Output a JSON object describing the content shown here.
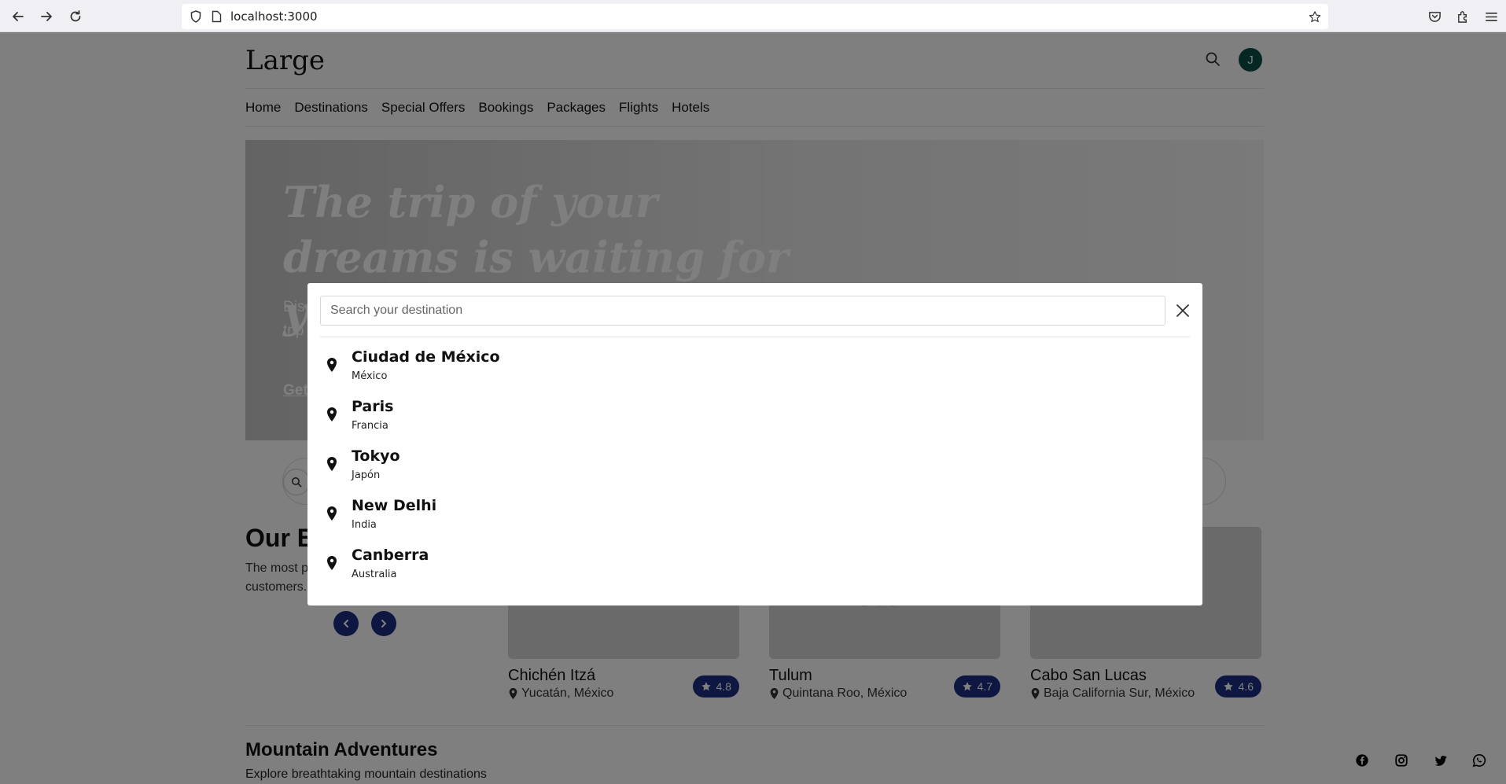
{
  "browser": {
    "url": "localhost:3000"
  },
  "site": {
    "brand": "Large",
    "avatar_initial": "J",
    "nav": [
      "Home",
      "Destinations",
      "Special Offers",
      "Bookings",
      "Packages",
      "Flights",
      "Hotels"
    ]
  },
  "hero": {
    "title": "The trip of your dreams is waiting for you",
    "description": "Discover amazing destinations and receive exclusive offers to make the best of your trip",
    "cta": "Get started"
  },
  "best_section": {
    "title": "Our Best Destinations",
    "description": "The most popular destinations for our customers. Find out what"
  },
  "cards": [
    {
      "image_text": "Chichén Itzá",
      "name": "Chichén Itzá",
      "location": "Yucatán, México",
      "rating": "4.8"
    },
    {
      "image_text": "Tulum",
      "name": "Tulum",
      "location": "Quintana Roo, México",
      "rating": "4.7"
    },
    {
      "image_text": "Cabo San Lucas",
      "name": "Cabo San Lucas",
      "location": "Baja California Sur, México",
      "rating": "4.6"
    }
  ],
  "mountain_section": {
    "title": "Mountain Adventures",
    "description": "Explore breathtaking mountain destinations"
  },
  "modal": {
    "search_placeholder": "Search your destination",
    "search_value": "",
    "results": [
      {
        "city": "Ciudad de México",
        "country": "México"
      },
      {
        "city": "Paris",
        "country": "Francia"
      },
      {
        "city": "Tokyo",
        "country": "Japón"
      },
      {
        "city": "New Delhi",
        "country": "India"
      },
      {
        "city": "Canberra",
        "country": "Australia"
      }
    ]
  },
  "colors": {
    "accent": "#1b2f83",
    "avatar_bg": "#0b4f47",
    "overlay": "rgba(0,0,0,0.5)"
  },
  "icons": {
    "result_icon": "map-pin-icon",
    "close_icon": "close-icon",
    "social": [
      "facebook-icon",
      "instagram-icon",
      "twitter-icon",
      "whatsapp-icon"
    ]
  }
}
